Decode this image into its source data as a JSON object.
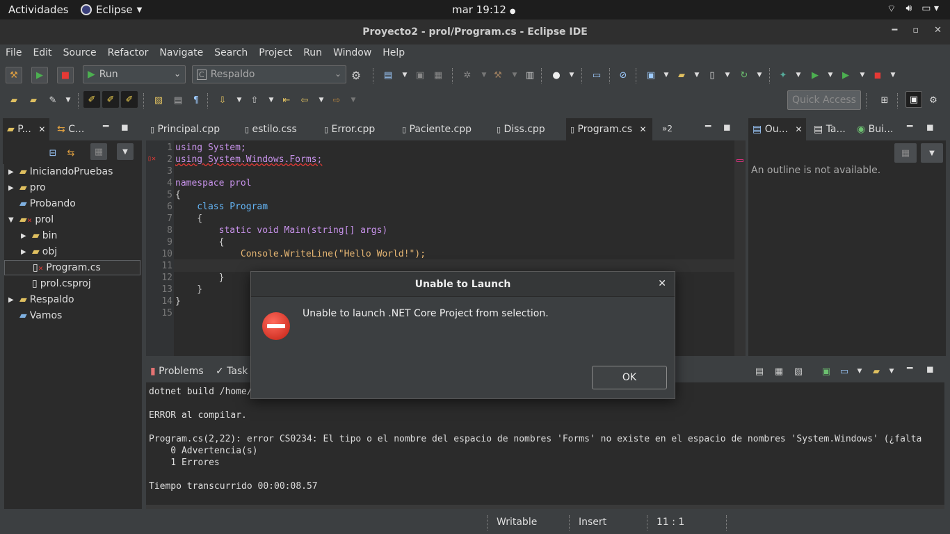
{
  "topbar": {
    "activities": "Actividades",
    "app_name": "Eclipse",
    "clock": "mar 19:12"
  },
  "window": {
    "title": "Proyecto2 - prol/Program.cs - Eclipse IDE"
  },
  "menu": [
    "File",
    "Edit",
    "Source",
    "Refactor",
    "Navigate",
    "Search",
    "Project",
    "Run",
    "Window",
    "Help"
  ],
  "toolbar": {
    "run_combo": "Run",
    "config_combo": "Respaldo",
    "quick_access": "Quick Access"
  },
  "left_panel": {
    "tab1": "P...",
    "tab2": "C...",
    "tree": [
      {
        "label": "IniciandoPruebas",
        "indent": 0,
        "expander": "▶"
      },
      {
        "label": "pro",
        "indent": 0,
        "expander": "▶"
      },
      {
        "label": "Probando",
        "indent": 0,
        "expander": ""
      },
      {
        "label": "prol",
        "indent": 0,
        "expander": "▼"
      },
      {
        "label": "bin",
        "indent": 1,
        "expander": "▶"
      },
      {
        "label": "obj",
        "indent": 1,
        "expander": "▶"
      },
      {
        "label": "Program.cs",
        "indent": 1,
        "expander": ""
      },
      {
        "label": "prol.csproj",
        "indent": 1,
        "expander": ""
      },
      {
        "label": "Respaldo",
        "indent": 0,
        "expander": "▶"
      },
      {
        "label": "Vamos",
        "indent": 0,
        "expander": ""
      }
    ]
  },
  "editor": {
    "tabs": [
      "Principal.cpp",
      "estilo.css",
      "Error.cpp",
      "Paciente.cpp",
      "Diss.cpp",
      "Program.cs"
    ],
    "more_tabs": "»2",
    "line_numbers": [
      "1",
      "2",
      "3",
      "4",
      "5",
      "6",
      "7",
      "8",
      "9",
      "10",
      "11",
      "12",
      "13",
      "14",
      "15"
    ],
    "lines": [
      "using System;",
      "using System.Windows.Forms;",
      "",
      "namespace prol",
      "{",
      "    class Program",
      "    {",
      "        static void Main(string[] args)",
      "        {",
      "            Console.WriteLine(\"Hello World!\");",
      "",
      "        }",
      "    }",
      "}",
      ""
    ]
  },
  "outline_panel": {
    "tabs": [
      "Ou...",
      "Ta...",
      "Bui..."
    ],
    "message": "An outline is not available."
  },
  "console_panel": {
    "tabs": [
      "Problems",
      "Task"
    ],
    "lines": [
      "dotnet build /home/al",
      "",
      "ERROR al compilar.",
      "",
      "Program.cs(2,22): error CS0234: El tipo o el nombre del espacio de nombres 'Forms' no existe en el espacio de nombres 'System.Windows' (¿falta",
      "    0 Advertencia(s)",
      "    1 Errores",
      "",
      "Tiempo transcurrido 00:00:08.57"
    ]
  },
  "statusbar": {
    "writable": "Writable",
    "insert": "Insert",
    "position": "11 : 1"
  },
  "dialog": {
    "title": "Unable to Launch",
    "message": "Unable to launch .NET Core Project from selection.",
    "ok_label": "OK"
  }
}
